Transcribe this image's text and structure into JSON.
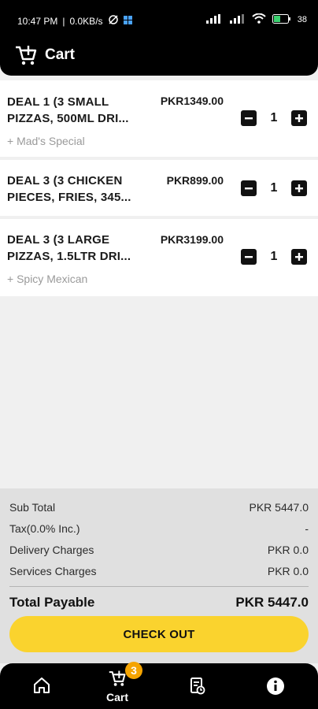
{
  "status_bar": {
    "time": "10:47 PM",
    "speed": "0.0KB/s",
    "battery": "38"
  },
  "header": {
    "title": "Cart",
    "icon": "cart-add-icon"
  },
  "cart_items": [
    {
      "name": "DEAL 1 (3 SMALL PIZZAS, 500ML DRI...",
      "name_line1": "DEAL 1 (3 SMALL",
      "name_line2": "PIZZAS, 500ML DRI...",
      "price": "PKR1349.00",
      "addon": "+ Mad's Special",
      "quantity": "1"
    },
    {
      "name": "DEAL 3 (3 CHICKEN PIECES, FRIES, 345...",
      "name_line1": "DEAL 3 (3 CHICKEN",
      "name_line2": "PIECES, FRIES, 345...",
      "price": "PKR899.00",
      "addon": "",
      "quantity": "1"
    },
    {
      "name": "DEAL 3 (3 LARGE PIZZAS, 1.5LTR DRI...",
      "name_line1": "DEAL 3 (3 LARGE",
      "name_line2": "PIZZAS, 1.5LTR DRI...",
      "price": "PKR3199.00",
      "addon": "+ Spicy Mexican",
      "quantity": "1"
    }
  ],
  "summary": {
    "subtotal_label": "Sub Total",
    "subtotal_value": "PKR 5447.0",
    "tax_label": "Tax(0.0% Inc.)",
    "tax_value": "-",
    "delivery_label": "Delivery Charges",
    "delivery_value": "PKR 0.0",
    "services_label": "Services Charges",
    "services_value": "PKR 0.0",
    "total_label": "Total Payable",
    "total_value": "PKR 5447.0"
  },
  "checkout_label": "CHECK OUT",
  "bottom_nav": {
    "cart_label": "Cart",
    "cart_badge": "3"
  },
  "colors": {
    "accent": "#fad32e",
    "badge": "#f5a400",
    "bar": "#000000"
  }
}
